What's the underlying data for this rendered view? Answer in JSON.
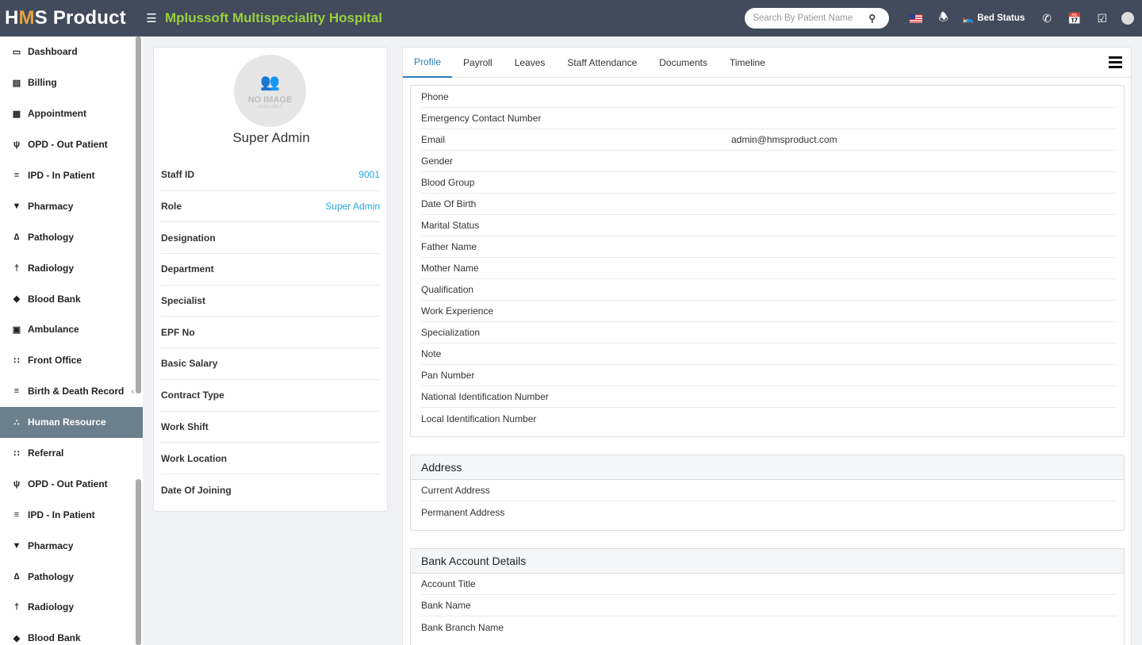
{
  "header": {
    "logo_h": "H",
    "logo_m": "M",
    "logo_rest": "S Product",
    "hospital_name": "Mplussoft Multispeciality Hospital",
    "search_placeholder": "Search By Patient Name",
    "bed_status_label": "Bed Status"
  },
  "sidebar": {
    "items": [
      {
        "label": "Dashboard",
        "icon": "monitor-icon"
      },
      {
        "label": "Billing",
        "icon": "file-icon"
      },
      {
        "label": "Appointment",
        "icon": "calendar-icon"
      },
      {
        "label": "OPD - Out Patient",
        "icon": "stethoscope-icon"
      },
      {
        "label": "IPD - In Patient",
        "icon": "procedure-bed-icon"
      },
      {
        "label": "Pharmacy",
        "icon": "mortar-pestle-icon"
      },
      {
        "label": "Pathology",
        "icon": "flask-icon"
      },
      {
        "label": "Radiology",
        "icon": "microscope-icon"
      },
      {
        "label": "Blood Bank",
        "icon": "droplet-icon"
      },
      {
        "label": "Ambulance",
        "icon": "ambulance-icon"
      },
      {
        "label": "Front Office",
        "icon": "users-icon"
      },
      {
        "label": "Birth & Death Record",
        "icon": "birth-death-icon"
      },
      {
        "label": "Human Resource",
        "icon": "sitemap-icon"
      },
      {
        "label": "Referral",
        "icon": "referral-icon"
      },
      {
        "label": "OPD - Out Patient",
        "icon": "stethoscope-icon"
      },
      {
        "label": "IPD - In Patient",
        "icon": "procedure-bed-icon"
      },
      {
        "label": "Pharmacy",
        "icon": "mortar-pestle-icon"
      },
      {
        "label": "Pathology",
        "icon": "flask-icon"
      },
      {
        "label": "Radiology",
        "icon": "microscope-icon"
      },
      {
        "label": "Blood Bank",
        "icon": "droplet-icon"
      }
    ],
    "active_index": 12
  },
  "profile": {
    "no_image_line1": "NO IMAGE",
    "no_image_line2": "AVAILABLE",
    "name": "Super Admin",
    "fields": [
      {
        "label": "Staff ID",
        "value": "9001"
      },
      {
        "label": "Role",
        "value": "Super Admin"
      },
      {
        "label": "Designation",
        "value": ""
      },
      {
        "label": "Department",
        "value": ""
      },
      {
        "label": "Specialist",
        "value": ""
      },
      {
        "label": "EPF No",
        "value": ""
      },
      {
        "label": "Basic Salary",
        "value": ""
      },
      {
        "label": "Contract Type",
        "value": ""
      },
      {
        "label": "Work Shift",
        "value": ""
      },
      {
        "label": "Work Location",
        "value": ""
      },
      {
        "label": "Date Of Joining",
        "value": ""
      }
    ]
  },
  "tabs": [
    "Profile",
    "Payroll",
    "Leaves",
    "Staff Attendance",
    "Documents",
    "Timeline"
  ],
  "details": [
    {
      "label": "Phone",
      "value": ""
    },
    {
      "label": "Emergency Contact Number",
      "value": ""
    },
    {
      "label": "Email",
      "value": "admin@hmsproduct.com"
    },
    {
      "label": "Gender",
      "value": ""
    },
    {
      "label": "Blood Group",
      "value": ""
    },
    {
      "label": "Date Of Birth",
      "value": ""
    },
    {
      "label": "Marital Status",
      "value": ""
    },
    {
      "label": "Father Name",
      "value": ""
    },
    {
      "label": "Mother Name",
      "value": ""
    },
    {
      "label": "Qualification",
      "value": ""
    },
    {
      "label": "Work Experience",
      "value": ""
    },
    {
      "label": "Specialization",
      "value": ""
    },
    {
      "label": "Note",
      "value": ""
    },
    {
      "label": "Pan Number",
      "value": ""
    },
    {
      "label": "National Identification Number",
      "value": ""
    },
    {
      "label": "Local Identification Number",
      "value": ""
    }
  ],
  "address": {
    "title": "Address",
    "rows": [
      {
        "label": "Current Address",
        "value": ""
      },
      {
        "label": "Permanent Address",
        "value": ""
      }
    ]
  },
  "bank": {
    "title": "Bank Account Details",
    "rows": [
      {
        "label": "Account Title",
        "value": ""
      },
      {
        "label": "Bank Name",
        "value": ""
      },
      {
        "label": "Bank Branch Name",
        "value": ""
      }
    ]
  }
}
